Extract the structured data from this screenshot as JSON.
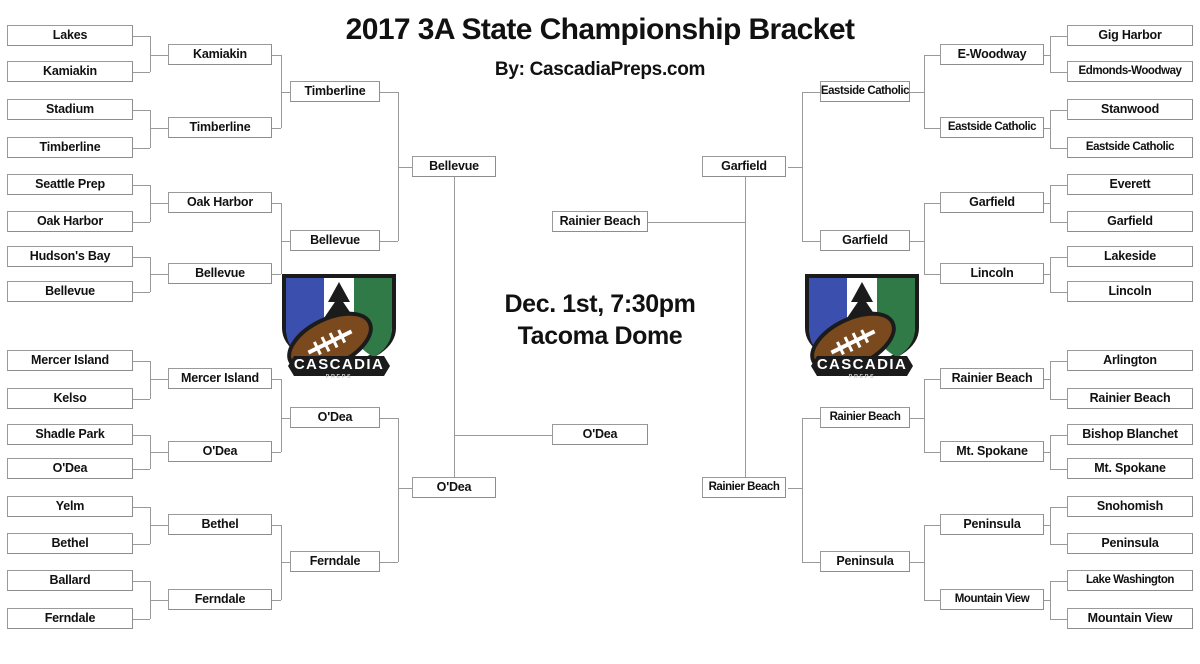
{
  "header": {
    "title": "2017 3A State Championship Bracket",
    "byline": "By: CascadiaPreps.com"
  },
  "final_game": {
    "date_time": "Dec. 1st, 7:30pm",
    "venue": "Tacoma Dome"
  },
  "logo": {
    "name": "cascadia-preps-logo",
    "wordmark": "CASCADIA",
    "subtext": "PREPS",
    "colors": {
      "blue": "#3b4fae",
      "white": "#ffffff",
      "green": "#2f7a46",
      "football": "#7a4a1e",
      "outline": "#1b1b1b"
    }
  },
  "bracket": {
    "left": {
      "round1": [
        "Lakes",
        "Kamiakin",
        "Stadium",
        "Timberline",
        "Seattle Prep",
        "Oak Harbor",
        "Hudson's Bay",
        "Bellevue",
        "Mercer Island",
        "Kelso",
        "Shadle Park",
        "O'Dea",
        "Yelm",
        "Bethel",
        "Ballard",
        "Ferndale"
      ],
      "round2": [
        "Kamiakin",
        "Timberline",
        "Oak Harbor",
        "Bellevue",
        "Mercer Island",
        "O'Dea",
        "Bethel",
        "Ferndale"
      ],
      "round3": [
        "Timberline",
        "Bellevue",
        "O'Dea",
        "Ferndale"
      ],
      "round4": [
        "Bellevue",
        "O'Dea"
      ],
      "semifinal": "O'Dea"
    },
    "right": {
      "round1": [
        "Gig Harbor",
        "Edmonds-Woodway",
        "Stanwood",
        "Eastside Catholic",
        "Everett",
        "Garfield",
        "Lakeside",
        "Lincoln",
        "Arlington",
        "Rainier Beach",
        "Bishop Blanchet",
        "Mt. Spokane",
        "Snohomish",
        "Peninsula",
        "Lake Washington",
        "Mountain View"
      ],
      "round2": [
        "E-Woodway",
        "Eastside Catholic",
        "Garfield",
        "Lincoln",
        "Rainier Beach",
        "Mt. Spokane",
        "Peninsula",
        "Mountain View"
      ],
      "round3": [
        "Eastside Catholic",
        "Garfield",
        "Rainier Beach",
        "Peninsula"
      ],
      "round4": [
        "Garfield",
        "Rainier Beach"
      ],
      "semifinal": "Rainier Beach"
    }
  }
}
